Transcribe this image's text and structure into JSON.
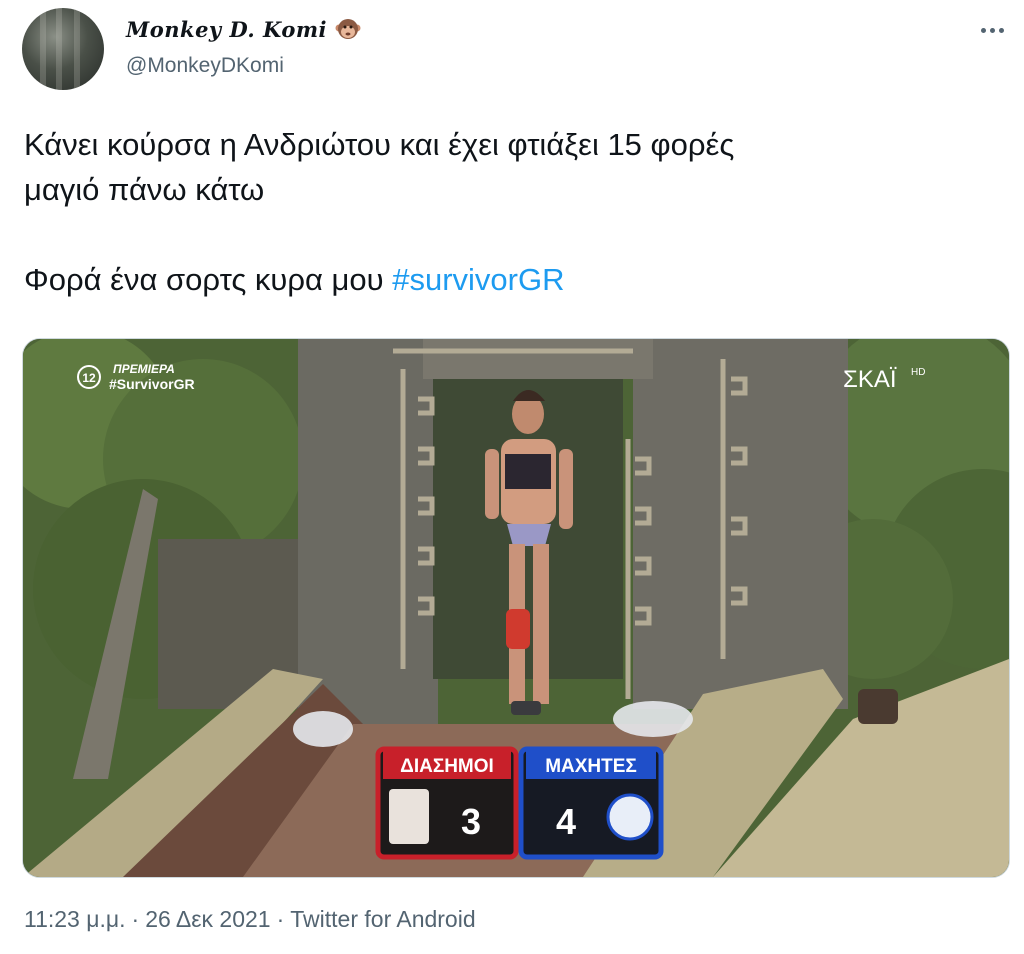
{
  "author": {
    "display_name": "Monkey D. Komi",
    "emoji_icon": "monkey-face-icon",
    "handle": "@MonkeyDKomi"
  },
  "menu": {
    "icon": "more-options-icon"
  },
  "tweet": {
    "line1": "Κάνει κούρσα η Ανδριώτου και έχει φτιάξει 15 φορές",
    "line2": "μαγιό πάνω κάτω",
    "line3_text": "Φορά ένα σορτς κυρα μου ",
    "hashtag": "#survivorGR"
  },
  "media": {
    "overlay_line1": "ΠΡΕΜΙΕΡΑ",
    "overlay_line2": "#SurvivorGR",
    "channel_number": "12",
    "channel_logo": "ΣΚΑΪ",
    "channel_logo_suffix": "HD",
    "team_left": "ΔΙΑΣΗΜΟΙ",
    "score_left": "3",
    "team_right": "ΜΑΧΗΤΕΣ",
    "score_right": "4",
    "colors": {
      "team_left": "#c8202a",
      "team_right": "#1f4fc9"
    }
  },
  "meta": {
    "time": "11:23 μ.μ.",
    "sep1": "·",
    "date": "26 Δεκ 2021",
    "sep2": "·",
    "source": "Twitter for Android"
  }
}
